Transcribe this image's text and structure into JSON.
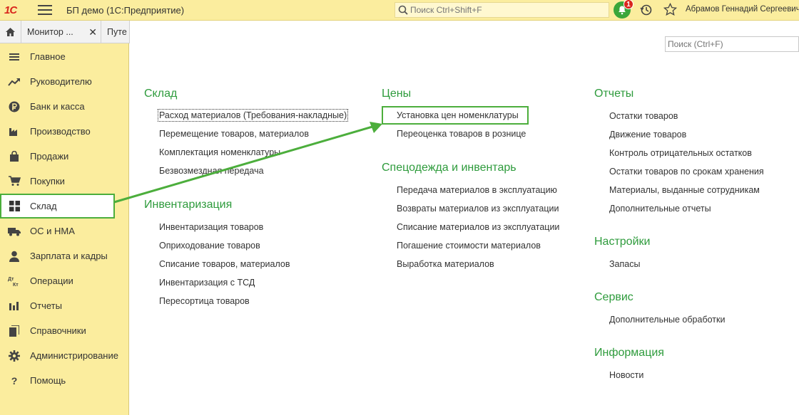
{
  "header": {
    "logo": "1С",
    "app_title": "БП демо  (1С:Предприятие)",
    "search_placeholder": "Поиск Ctrl+Shift+F",
    "notification_count": "1",
    "user_name": "Абрамов Геннадий Сергеевич"
  },
  "tabs": [
    {
      "label": "Монитор ..."
    },
    {
      "label": "Путе"
    }
  ],
  "sidebar": {
    "items": [
      {
        "label": "Главное",
        "icon": "hamburger-icon"
      },
      {
        "label": "Руководителю",
        "icon": "trend-icon"
      },
      {
        "label": "Банк и касса",
        "icon": "ruble-icon"
      },
      {
        "label": "Производство",
        "icon": "factory-icon"
      },
      {
        "label": "Продажи",
        "icon": "shopping-bag-icon"
      },
      {
        "label": "Покупки",
        "icon": "cart-icon"
      },
      {
        "label": "Склад",
        "icon": "grid-icon",
        "active": true
      },
      {
        "label": "ОС и НМА",
        "icon": "truck-icon"
      },
      {
        "label": "Зарплата и кадры",
        "icon": "person-icon"
      },
      {
        "label": "Операции",
        "icon": "dt-kt-icon"
      },
      {
        "label": "Отчеты",
        "icon": "bar-chart-icon"
      },
      {
        "label": "Справочники",
        "icon": "books-icon"
      },
      {
        "label": "Администрирование",
        "icon": "gear-icon"
      },
      {
        "label": "Помощь",
        "icon": "question-icon"
      }
    ]
  },
  "main": {
    "search_placeholder": "Поиск (Ctrl+F)",
    "sections": {
      "sklad": {
        "title": "Склад",
        "links": [
          "Расход материалов (Требования-накладные)",
          "Перемещение товаров, материалов",
          "Комплектация номенклатуры",
          "Безвозмездная передача"
        ]
      },
      "inventarizaciya": {
        "title": "Инвентаризация",
        "links": [
          "Инвентаризация товаров",
          "Оприходование товаров",
          "Списание товаров, материалов",
          "Инвентаризация с ТСД",
          "Пересортица товаров"
        ]
      },
      "ceny": {
        "title": "Цены",
        "links": [
          "Установка цен номенклатуры",
          "Переоценка товаров в рознице"
        ]
      },
      "specodezhda": {
        "title": "Спецодежда и инвентарь",
        "links": [
          "Передача материалов в эксплуатацию",
          "Возвраты материалов из эксплуатации",
          "Списание материалов из эксплуатации",
          "Погашение стоимости материалов",
          "Выработка материалов"
        ]
      },
      "otchety": {
        "title": "Отчеты",
        "links": [
          "Остатки товаров",
          "Движение товаров",
          "Контроль отрицательных остатков",
          "Остатки товаров по срокам хранения",
          "Материалы, выданные сотрудникам",
          "Дополнительные отчеты"
        ]
      },
      "nastroyki": {
        "title": "Настройки",
        "links": [
          "Запасы"
        ]
      },
      "servis": {
        "title": "Сервис",
        "links": [
          "Дополнительные обработки"
        ]
      },
      "informaciya": {
        "title": "Информация",
        "links": [
          "Новости"
        ]
      }
    }
  },
  "colors": {
    "accent_green": "#2e9b3c",
    "highlight_green": "#4cae3c",
    "sidebar_bg": "#fbed9e"
  }
}
